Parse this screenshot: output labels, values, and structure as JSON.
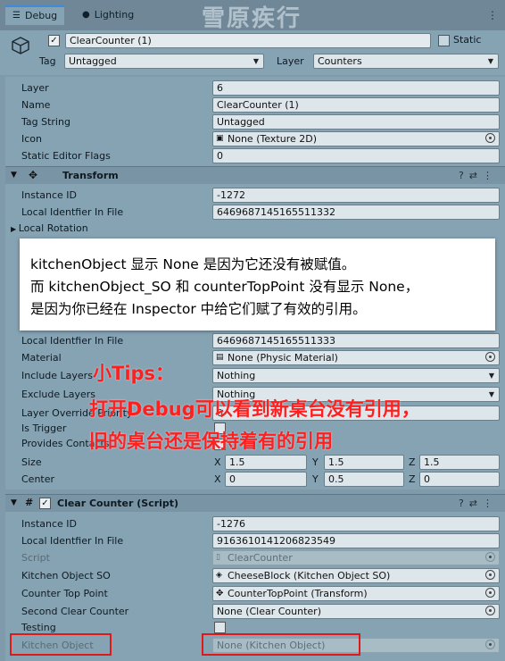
{
  "tabs": [
    {
      "label": "Debug",
      "icon": "list-icon",
      "active": true
    },
    {
      "label": "Lighting",
      "icon": "bulb-icon",
      "active": false
    }
  ],
  "watermark": "雪原疾行",
  "object": {
    "active": "✓",
    "name": "ClearCounter (1)",
    "static_label": "Static",
    "tag_label": "Tag",
    "tag_value": "Untagged",
    "layer_label": "Layer",
    "layer_value": "Counters"
  },
  "gameobject_rows": [
    {
      "label": "Layer",
      "value": "6"
    },
    {
      "label": "Name",
      "value": "ClearCounter (1)"
    },
    {
      "label": "Tag String",
      "value": "Untagged"
    },
    {
      "label": "Icon",
      "value": "None (Texture 2D)"
    },
    {
      "label": "Static Editor Flags",
      "value": "0"
    }
  ],
  "transform": {
    "title": "Transform",
    "instance_id_label": "Instance ID",
    "instance_id": "-1272",
    "local_id_label": "Local Identfier In File",
    "local_id": "6469687145165511332",
    "local_rotation_label": "Local Rotation"
  },
  "tooltip": {
    "line1": "kitchenObject 显示 None 是因为它还没有被赋值。",
    "line2": "而 kitchenObject_SO 和 counterTopPoint 没有显示 None，",
    "line3": "是因为你已经在 Inspector 中给它们赋了有效的引用。"
  },
  "collider": {
    "local_id_label": "Local Identfier In File",
    "local_id": "6469687145165511333",
    "material_label": "Material",
    "material_value": "None (Physic Material)",
    "include_label": "Include Layers",
    "include_value": "Nothing",
    "exclude_label": "Exclude Layers",
    "exclude_value": "Nothing",
    "override_label": "Layer Override Priority",
    "override_value": "0",
    "trigger_label": "Is Trigger",
    "contacts_label": "Provides Contacts",
    "size_label": "Size",
    "size": {
      "x": "1.5",
      "y": "1.5",
      "z": "1.5"
    },
    "center_label": "Center",
    "center": {
      "x": "0",
      "y": "0.5",
      "z": "0"
    },
    "axis": {
      "x": "X",
      "y": "Y",
      "z": "Z"
    }
  },
  "tips": {
    "title": "小Tips：",
    "line1": "打开Debug可以看到新桌台没有引用，",
    "line2": "旧的桌台还是保持着有的引用"
  },
  "script": {
    "title": "Clear Counter (Script)",
    "instance_id_label": "Instance ID",
    "instance_id": "-1276",
    "local_id_label": "Local Identfier In File",
    "local_id": "9163610141206823549",
    "script_label": "Script",
    "script_value": "ClearCounter",
    "kso_label": "Kitchen Object SO",
    "kso_value": "CheeseBlock (Kitchen Object SO)",
    "ctp_label": "Counter Top Point",
    "ctp_value": "CounterTopPoint (Transform)",
    "scc_label": "Second Clear Counter",
    "scc_value": "None (Clear Counter)",
    "testing_label": "Testing",
    "ko_label": "Kitchen Object",
    "ko_value": "None (Kitchen Object)"
  },
  "colors": {
    "highlight_box": "#e01818",
    "tips_text": "#ff1f1f",
    "inspector_bg": "#86a3b3"
  }
}
